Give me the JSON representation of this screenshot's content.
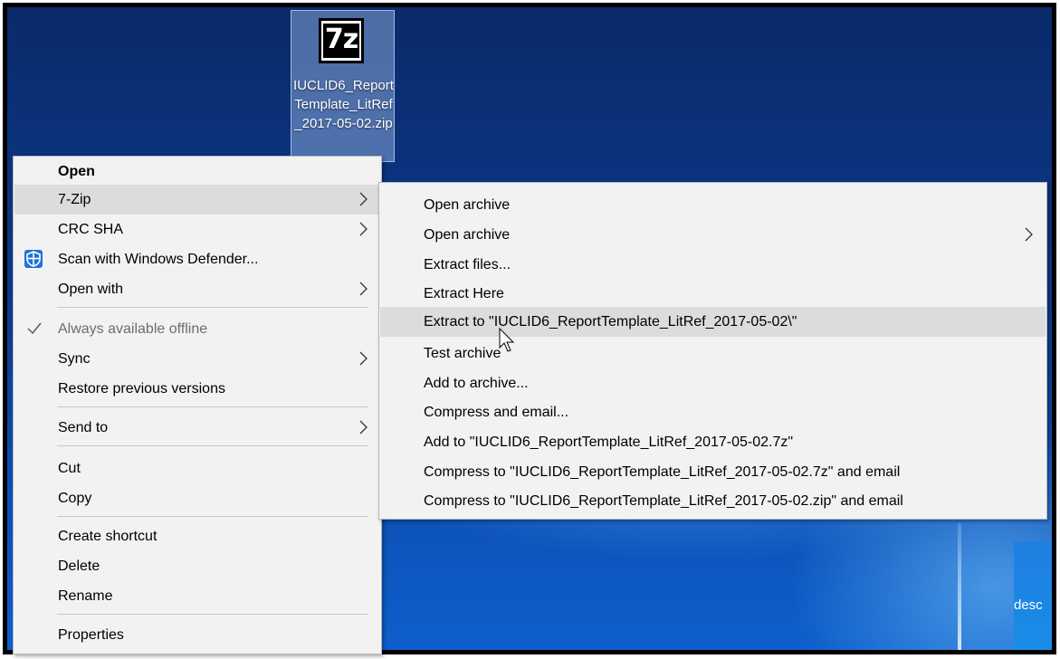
{
  "desktop": {
    "icon": {
      "logo_text": "7z",
      "label": "IUCLID6_ReportTemplate_LitRef_2017-05-02.zip"
    },
    "partial_label": "desc"
  },
  "context_menu": {
    "items": [
      {
        "label": "Open",
        "bold": true
      },
      {
        "label": "7-Zip",
        "submenu": true,
        "highlighted": true
      },
      {
        "label": "CRC SHA",
        "submenu": true
      },
      {
        "label": "Scan with Windows Defender...",
        "icon": "windows-defender-shield-icon"
      },
      {
        "label": "Open with",
        "submenu": true
      },
      {
        "label": "Always available offline",
        "checked": true,
        "disabled": true
      },
      {
        "label": "Sync",
        "submenu": true
      },
      {
        "label": "Restore previous versions"
      },
      {
        "label": "Send to",
        "submenu": true
      },
      {
        "label": "Cut"
      },
      {
        "label": "Copy"
      },
      {
        "label": "Create shortcut"
      },
      {
        "label": "Delete"
      },
      {
        "label": "Rename"
      },
      {
        "label": "Properties"
      }
    ]
  },
  "sevenzip_submenu": {
    "items": [
      {
        "label": "Open archive"
      },
      {
        "label": "Open archive",
        "submenu": true
      },
      {
        "label": "Extract files..."
      },
      {
        "label": "Extract Here"
      },
      {
        "label": "Extract to \"IUCLID6_ReportTemplate_LitRef_2017-05-02\\\"",
        "highlighted": true
      },
      {
        "label": "Test archive"
      },
      {
        "label": "Add to archive..."
      },
      {
        "label": "Compress and email..."
      },
      {
        "label": "Add to \"IUCLID6_ReportTemplate_LitRef_2017-05-02.7z\""
      },
      {
        "label": "Compress to \"IUCLID6_ReportTemplate_LitRef_2017-05-02.7z\" and email"
      },
      {
        "label": "Compress to \"IUCLID6_ReportTemplate_LitRef_2017-05-02.zip\" and email"
      }
    ]
  },
  "colors": {
    "menu_bg": "#f2f2f2",
    "highlight": "#dcdcdc",
    "defender_blue": "#1e73d8"
  }
}
